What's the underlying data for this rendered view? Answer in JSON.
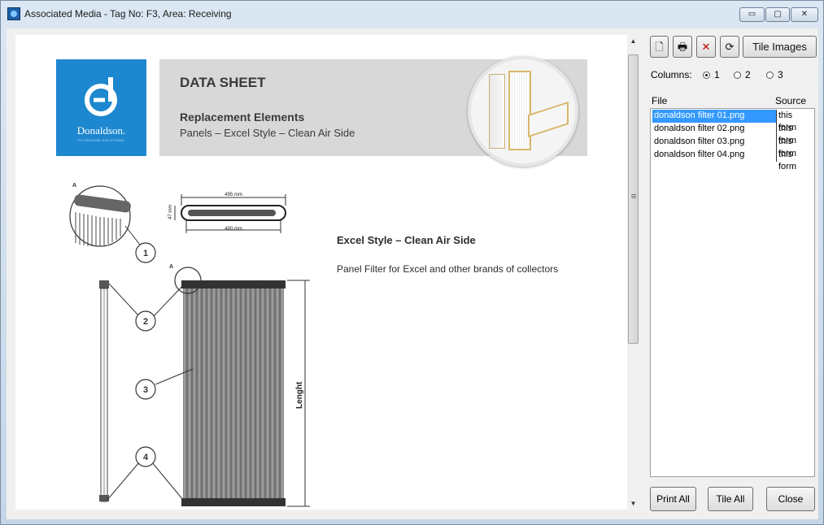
{
  "window": {
    "title": "Associated Media - Tag No: F3, Area: Receiving",
    "minimize_glyph": "▭",
    "maximize_glyph": "▢",
    "close_glyph": "✕"
  },
  "datasheet": {
    "brand": "Donaldson.",
    "brand_sub": "FILTRATION SOLUTIONS",
    "title": "DATA SHEET",
    "subtitle": "Replacement Elements",
    "subtitle2": "Panels – Excel Style – Clean Air Side",
    "heading": "Excel Style – Clean Air Side",
    "description": "Panel Filter for Excel and other brands of collectors",
    "dim_width_top": "495 mm",
    "dim_width_bottom": "480 mm",
    "dim_height": "47 mm",
    "detail_label": "A",
    "detail_label2": "A",
    "length_label": "Lenght",
    "callouts": [
      "1",
      "2",
      "3",
      "4"
    ]
  },
  "toolbar": {
    "new_icon": "new-document-icon",
    "print_icon": "printer-icon",
    "delete_icon": "delete-icon",
    "refresh_icon": "refresh-icon",
    "new_glyph": "🗋",
    "print_glyph": "🖶",
    "delete_glyph": "✕",
    "refresh_glyph": "⟳",
    "tile_images_label": "Tile Images"
  },
  "columns": {
    "label": "Columns:",
    "options": [
      "1",
      "2",
      "3"
    ],
    "selected": "1"
  },
  "file_list": {
    "header_file": "File",
    "header_source": "Source",
    "rows": [
      {
        "file": "donaldson filter 01.png",
        "source": "this form"
      },
      {
        "file": "donaldson filter 02.png",
        "source": "this form"
      },
      {
        "file": "donaldson filter 03.png",
        "source": "this form"
      },
      {
        "file": "donaldson filter 04.png",
        "source": "this form"
      }
    ]
  },
  "buttons": {
    "print_all": "Print All",
    "tile_all": "Tile All",
    "close": "Close"
  },
  "scroll": {
    "up_glyph": "▲",
    "down_glyph": "▼"
  }
}
